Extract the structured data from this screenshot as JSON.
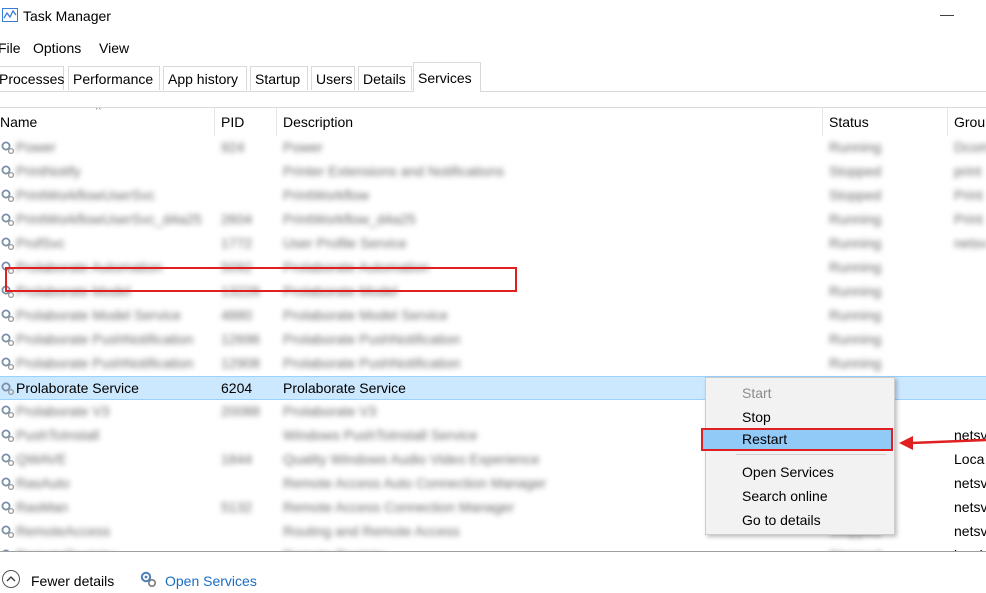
{
  "window": {
    "title": "Task Manager",
    "app_icon": "task-manager-icon",
    "minimize_glyph": "—"
  },
  "menu": [
    "File",
    "Options",
    "View"
  ],
  "tabs": [
    "Processes",
    "Performance",
    "App history",
    "Startup",
    "Users",
    "Details",
    "Services"
  ],
  "active_tab": "Services",
  "columns": {
    "name": "Name",
    "pid": "PID",
    "description": "Description",
    "status": "Status",
    "group": "Grou"
  },
  "rows": [
    {
      "name": "Power",
      "pid": "924",
      "description": "Power",
      "status": "Running",
      "group": "Dcom"
    },
    {
      "name": "PrintNotify",
      "pid": "",
      "description": "Printer Extensions and Notifications",
      "status": "Stopped",
      "group": "print"
    },
    {
      "name": "PrintWorkflowUserSvc",
      "pid": "",
      "description": "PrintWorkflow",
      "status": "Stopped",
      "group": "Print"
    },
    {
      "name": "PrintWorkflowUserSvc_d4a25",
      "pid": "2604",
      "description": "PrintWorkflow_d4a25",
      "status": "Running",
      "group": "Print"
    },
    {
      "name": "ProfSvc",
      "pid": "1772",
      "description": "User Profile Service",
      "status": "Running",
      "group": "netsv"
    },
    {
      "name": "Prolaborate Automation",
      "pid": "5092",
      "description": "Prolaborate Automation",
      "status": "Running",
      "group": ""
    },
    {
      "name": "Prolaborate Model",
      "pid": "13228",
      "description": "Prolaborate Model",
      "status": "Running",
      "group": ""
    },
    {
      "name": "Prolaborate Model Service",
      "pid": "4880",
      "description": "Prolaborate Model Service",
      "status": "Running",
      "group": ""
    },
    {
      "name": "Prolaborate PushNotification",
      "pid": "12696",
      "description": "Prolaborate PushNotification",
      "status": "Running",
      "group": ""
    },
    {
      "name": "Prolaborate PushNotification",
      "pid": "12908",
      "description": "Prolaborate PushNotification",
      "status": "Running",
      "group": ""
    },
    {
      "name": "Prolaborate Service",
      "pid": "6204",
      "description": "Prolaborate Service",
      "status": "",
      "group": "",
      "selected": true
    },
    {
      "name": "Prolaborate V3",
      "pid": "20088",
      "description": "Prolaborate V3",
      "status": "",
      "group": ""
    },
    {
      "name": "PushToInstall",
      "pid": "",
      "description": "Windows PushToInstall Service",
      "status": "",
      "group": "netsv"
    },
    {
      "name": "QWAVE",
      "pid": "1844",
      "description": "Quality Windows Audio Video Experience",
      "status": "",
      "group": "Loca"
    },
    {
      "name": "RasAuto",
      "pid": "",
      "description": "Remote Access Auto Connection Manager",
      "status": "",
      "group": "netsv"
    },
    {
      "name": "RasMan",
      "pid": "5132",
      "description": "Remote Access Connection Manager",
      "status": "",
      "group": "netsv"
    },
    {
      "name": "RemoteAccess",
      "pid": "",
      "description": "Routing and Remote Access",
      "status": "Stopped",
      "group": "netsv"
    },
    {
      "name": "RemoteRegistry",
      "pid": "",
      "description": "Remote Registry",
      "status": "Stopped",
      "group": "local"
    }
  ],
  "context_menu": [
    {
      "label": "Start",
      "state": "disabled"
    },
    {
      "label": "Stop",
      "state": "normal"
    },
    {
      "label": "Restart",
      "state": "hover"
    },
    {
      "label": "Open Services",
      "state": "normal"
    },
    {
      "label": "Search online",
      "state": "normal"
    },
    {
      "label": "Go to details",
      "state": "normal"
    }
  ],
  "footer": {
    "fewer_details": "Fewer details",
    "open_services": "Open Services"
  },
  "colors": {
    "selection": "#cce8ff",
    "highlight": "#e02020",
    "link": "#1a6ec2",
    "menu_hover": "#91c9f7"
  }
}
